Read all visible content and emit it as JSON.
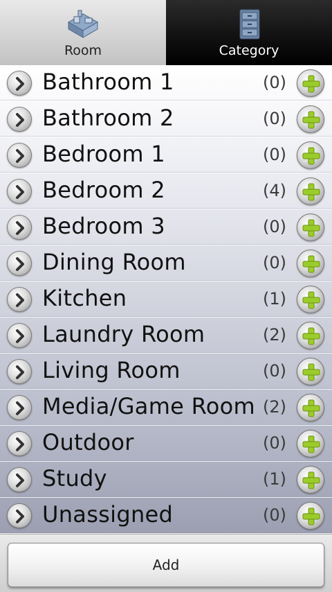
{
  "tabs": [
    {
      "label": "Room",
      "icon": "house-icon",
      "active": true
    },
    {
      "label": "Category",
      "icon": "cabinet-icon",
      "active": false
    }
  ],
  "rooms": [
    {
      "name": "Bathroom 1",
      "count": "(0)"
    },
    {
      "name": "Bathroom 2",
      "count": "(0)"
    },
    {
      "name": "Bedroom 1",
      "count": "(0)"
    },
    {
      "name": "Bedroom 2",
      "count": "(4)"
    },
    {
      "name": "Bedroom 3",
      "count": "(0)"
    },
    {
      "name": "Dining Room",
      "count": "(0)"
    },
    {
      "name": "Kitchen",
      "count": "(1)"
    },
    {
      "name": "Laundry Room",
      "count": "(2)"
    },
    {
      "name": "Living Room",
      "count": "(0)"
    },
    {
      "name": "Media/Game Room",
      "count": "(2)"
    },
    {
      "name": "Outdoor",
      "count": "(0)"
    },
    {
      "name": "Study",
      "count": "(1)"
    },
    {
      "name": "Unassigned",
      "count": "(0)"
    }
  ],
  "footer": {
    "add_label": "Add"
  },
  "colors": {
    "plus_green": "#9ccc2a",
    "active_tab": "#d4d4d4",
    "inactive_tab": "#000000"
  }
}
